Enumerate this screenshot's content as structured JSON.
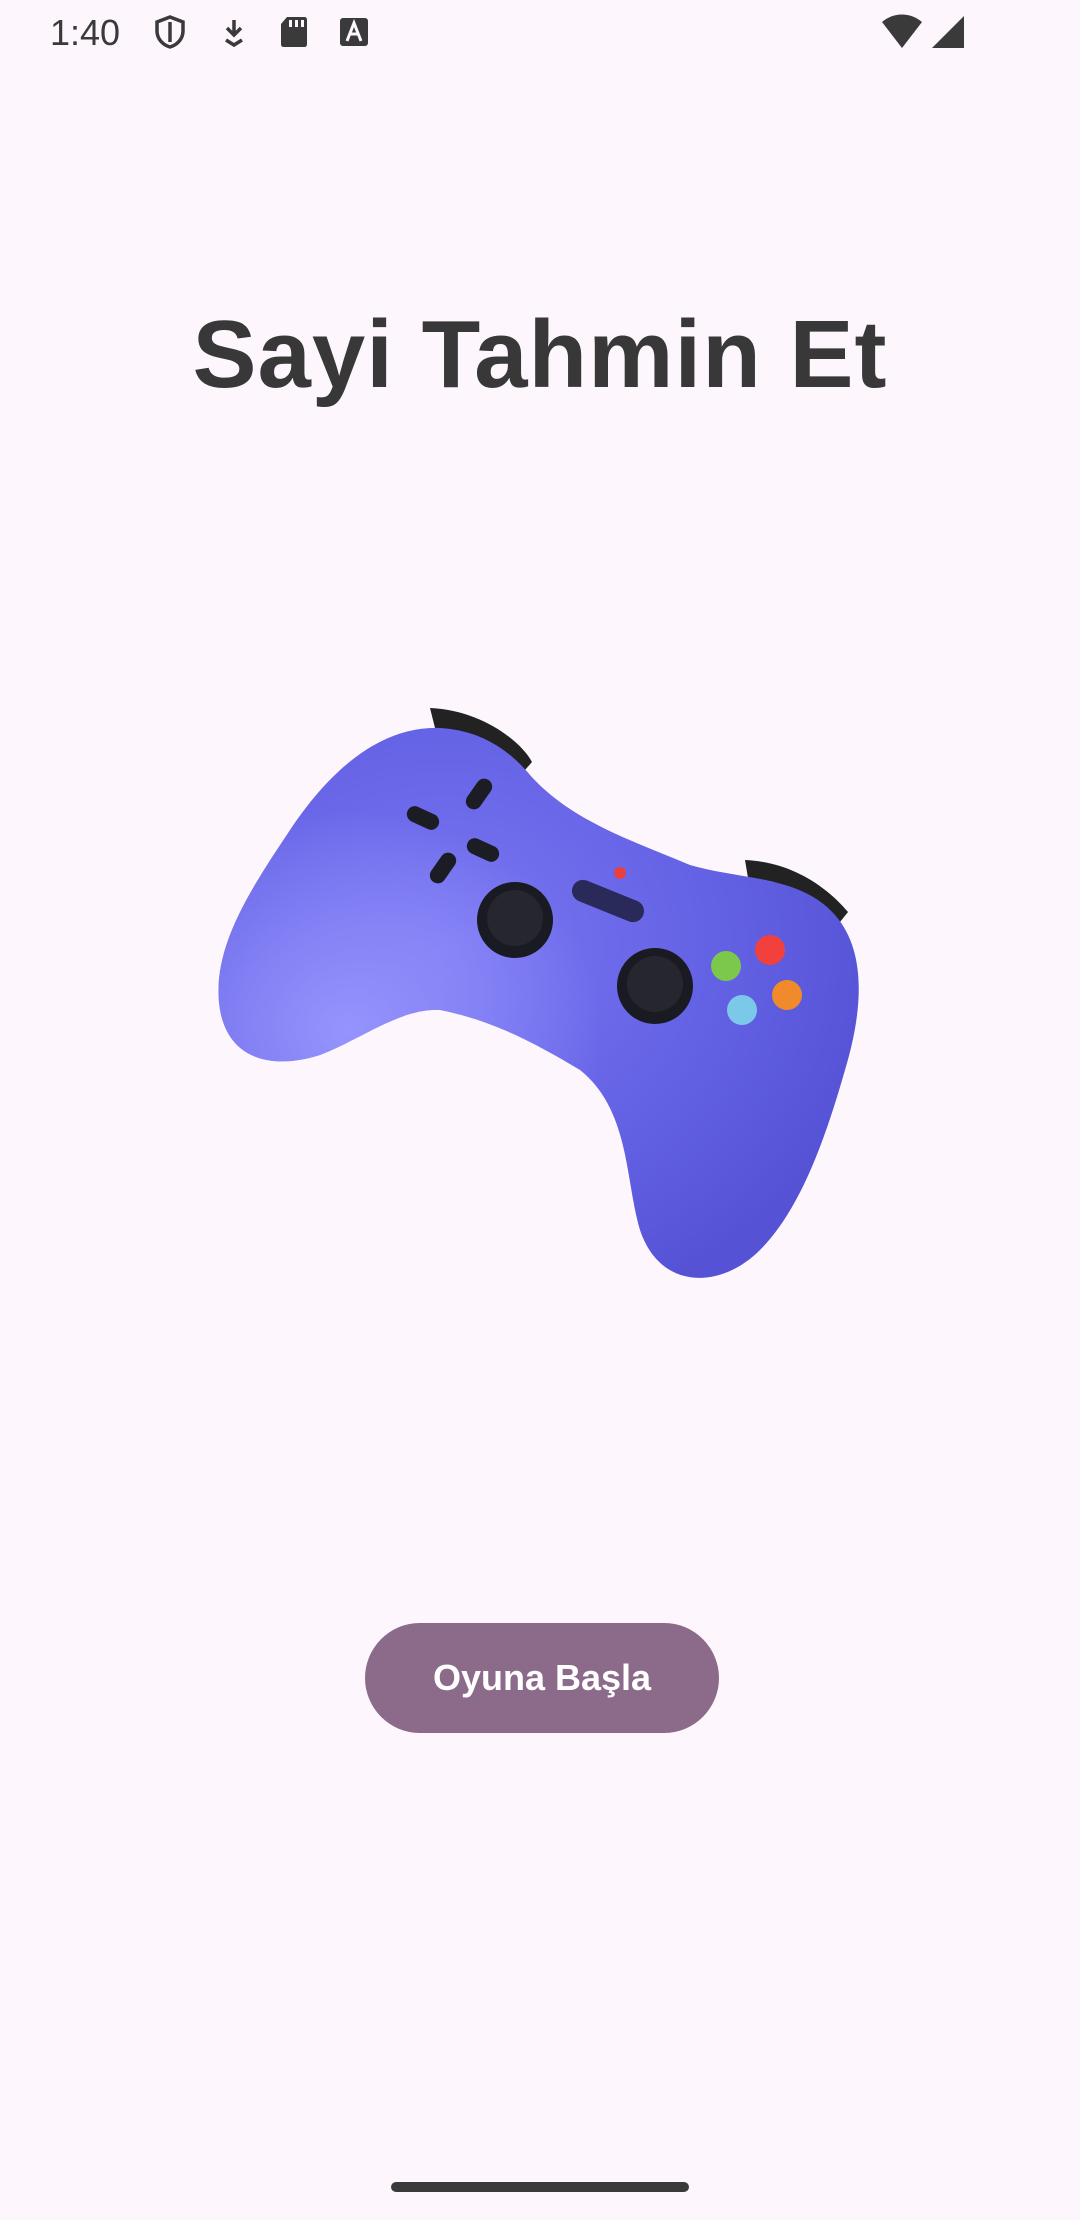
{
  "status_bar": {
    "time": "1:40",
    "icons": [
      "shield-icon",
      "download-icon",
      "sd-card-icon",
      "text-a-icon",
      "wifi-icon",
      "signal-icon"
    ]
  },
  "main": {
    "title": "Sayi Tahmin Et",
    "image": "game-controller-icon",
    "start_button_label": "Oyuna Başla"
  },
  "colors": {
    "background": "#fdf6fc",
    "button": "#8c6a8a",
    "controller_body": "#6a67e8",
    "title_text": "#383838"
  }
}
